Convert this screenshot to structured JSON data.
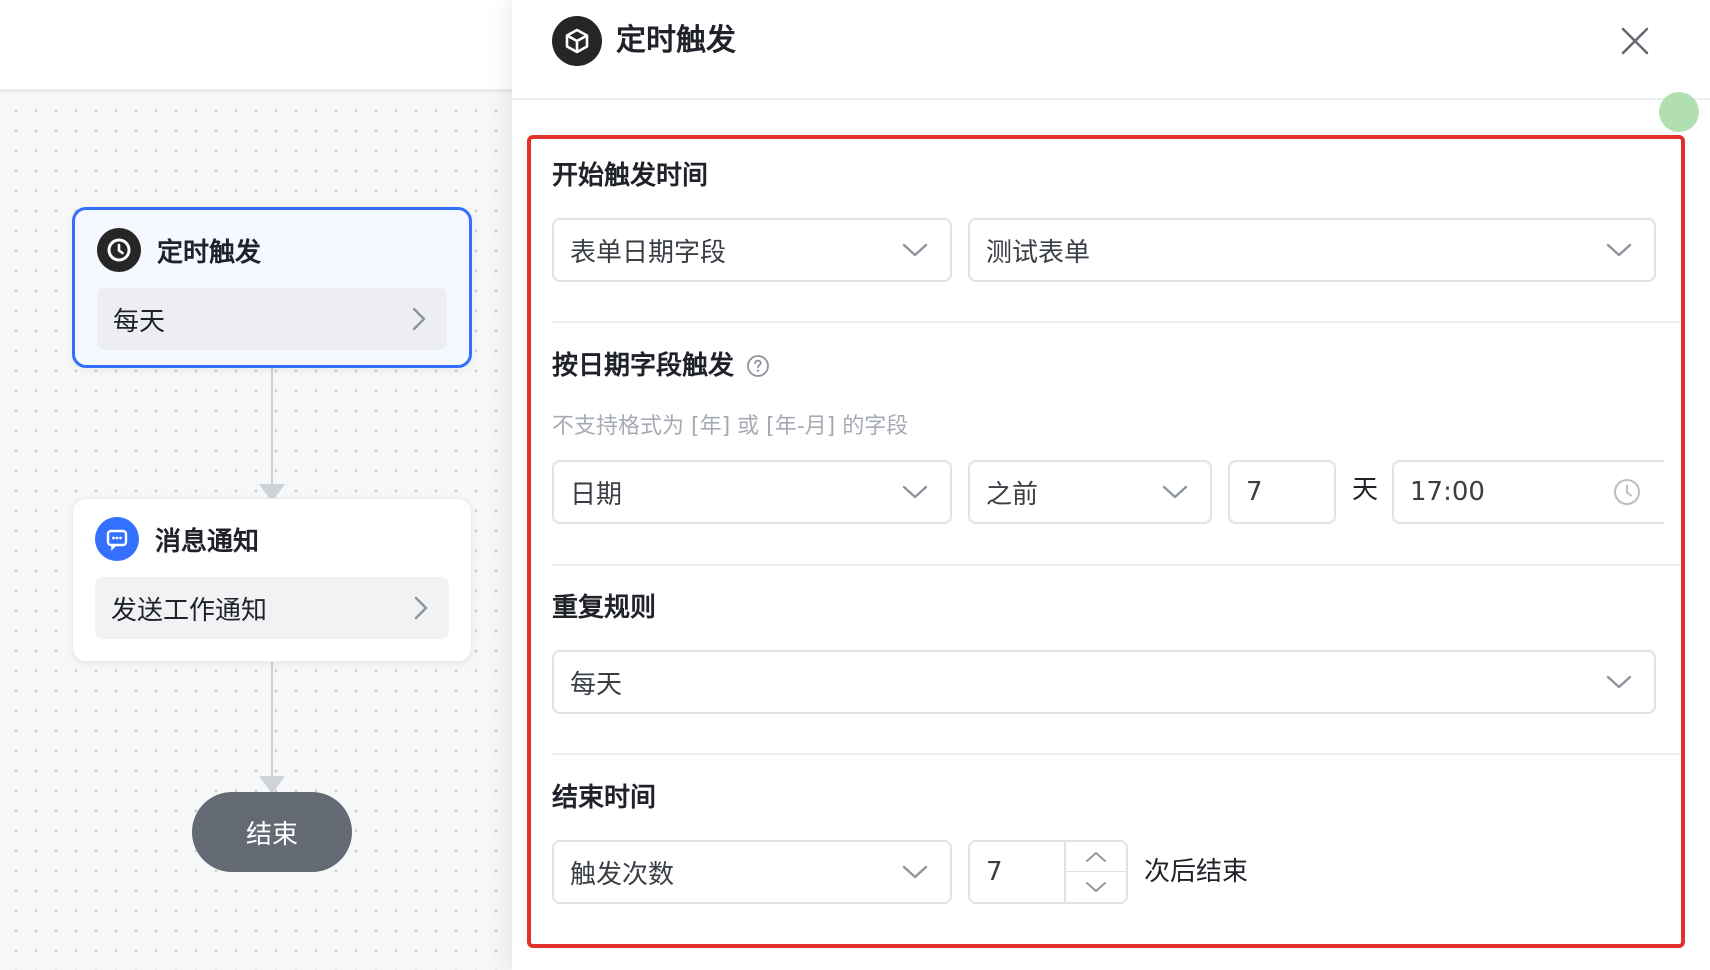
{
  "canvas": {
    "nodes": [
      {
        "title": "定时触发",
        "detail": "每天",
        "icon": "clock-icon"
      },
      {
        "title": "消息通知",
        "detail": "发送工作通知",
        "icon": "message-icon"
      }
    ],
    "end_label": "结束"
  },
  "panel": {
    "title": "定时触发",
    "icon": "cube-icon",
    "start_time": {
      "label": "开始触发时间",
      "source_select": "表单日期字段",
      "form_select": "测试表单"
    },
    "date_trigger": {
      "label": "按日期字段触发",
      "hint": "不支持格式为 [年] 或 [年-月] 的字段",
      "field_select": "日期",
      "direction_select": "之前",
      "offset_value": "7",
      "offset_unit": "天",
      "time_value": "17:00"
    },
    "repeat": {
      "label": "重复规则",
      "rule_select": "每天"
    },
    "end_time": {
      "label": "结束时间",
      "mode_select": "触发次数",
      "count_value": "7",
      "suffix": "次后结束"
    }
  },
  "colors": {
    "primary": "#3370ff",
    "highlight_border": "#e0312b",
    "end_node": "#646a73"
  }
}
